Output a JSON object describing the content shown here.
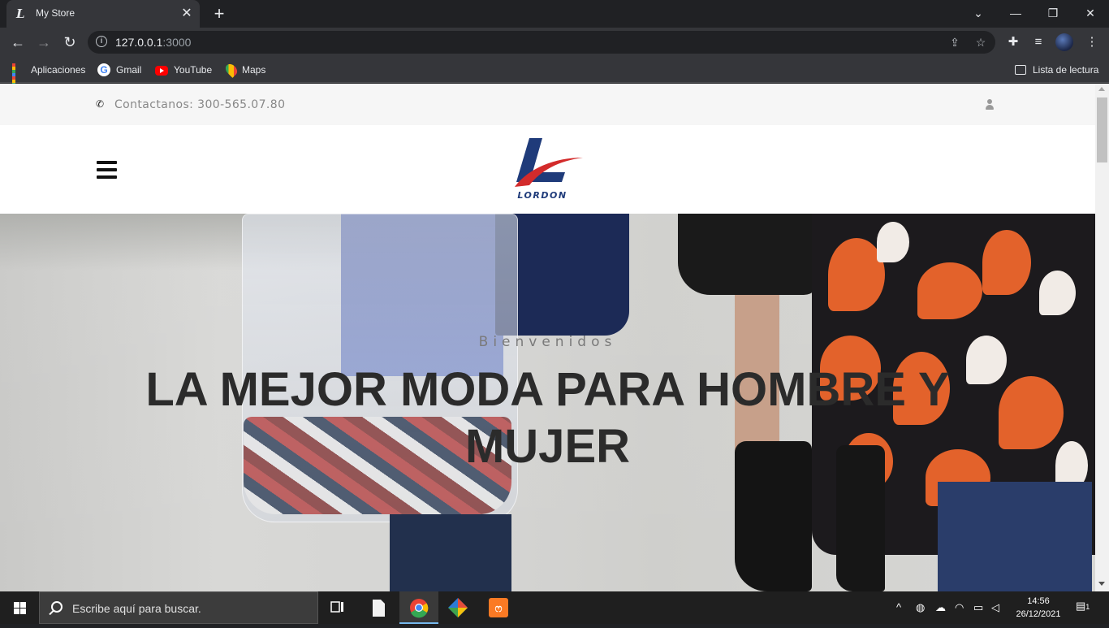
{
  "browser": {
    "tab_title": "My Store",
    "tab_close": "✕",
    "new_tab": "+",
    "url_host": "127.0.0.1",
    "url_port": ":3000",
    "window_buttons": {
      "minimize": "—",
      "restore": "❐",
      "close": "✕",
      "tab_search": "⌄"
    }
  },
  "bookmarks": [
    {
      "label": "Aplicaciones",
      "icon": "apps-grid-icon"
    },
    {
      "label": "Gmail",
      "icon": "google-icon"
    },
    {
      "label": "YouTube",
      "icon": "youtube-icon"
    },
    {
      "label": "Maps",
      "icon": "maps-icon"
    }
  ],
  "reading_list": "Lista de lectura",
  "site": {
    "contact": "Contactanos: 300-565.07.80",
    "brand": "LORDON",
    "hero": {
      "welcome": "Bienvenidos",
      "headline": "LA MEJOR MODA PARA HOMBRE Y MUJER"
    }
  },
  "taskbar": {
    "search_placeholder": "Escribe aquí para buscar.",
    "time": "14:56",
    "date": "26/12/2021",
    "notifications": "1"
  },
  "colors": {
    "brand_blue": "#1f3b7a",
    "brand_red": "#d32b2b",
    "chrome_dark": "#202124",
    "chrome_toolbar": "#35363a"
  }
}
